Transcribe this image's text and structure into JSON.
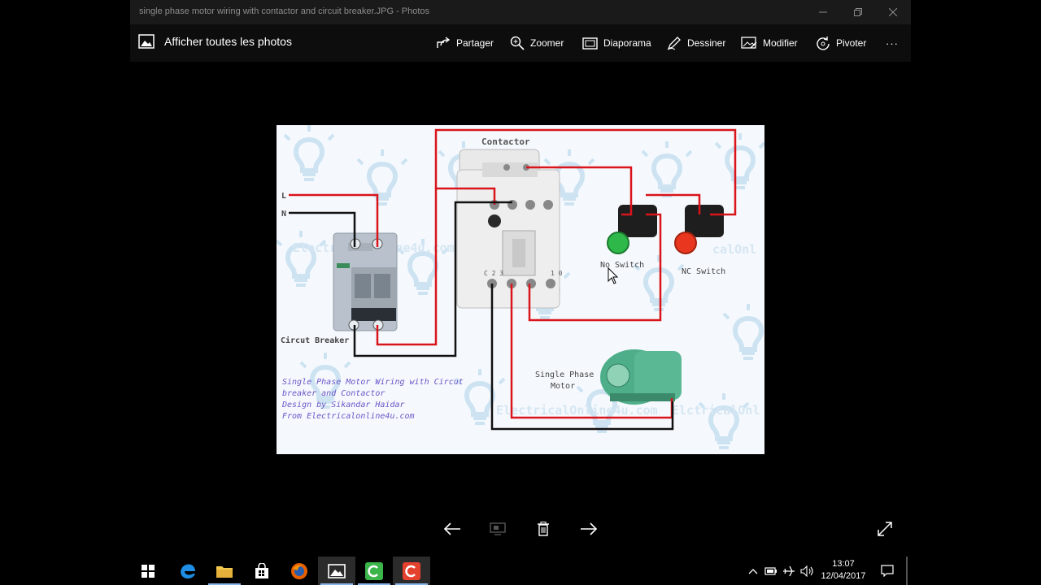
{
  "window": {
    "title": "single phase motor wiring with contactor and circuit breaker.JPG - Photos",
    "minimize_icon": "minimize-icon",
    "maximize_icon": "restore-icon",
    "close_icon": "close-icon"
  },
  "toolbar": {
    "all_photos_label": "Afficher toutes les photos",
    "share_label": "Partager",
    "zoom_label": "Zoomer",
    "slideshow_label": "Diaporama",
    "draw_label": "Dessiner",
    "edit_label": "Modifier",
    "rotate_label": "Pivoter",
    "more_label": "···"
  },
  "diagram": {
    "contactor_label": "Contactor",
    "L_label": "L",
    "N_label": "N",
    "breaker_label": "Circut Breaker",
    "no_switch_label": "No Switch",
    "nc_switch_label": "NC Switch",
    "motor_label_1": "Single Phase",
    "motor_label_2": "Motor",
    "caption_1": "Single Phase Motor Wiring with Circut",
    "caption_2": "breaker and Contactor",
    "caption_3": "Design by Sikandar Haidar",
    "caption_4": "From Electricalonline4u.com",
    "contactor_a1": "C 2 3",
    "contactor_no": "1 0",
    "watermark_1": "Electricalonline4u.com",
    "watermark_2": "ElectricalOnline4u.com",
    "watermark_3": "ElctricalOnl",
    "watermark_4": "calOnl",
    "colors": {
      "live": "#d9141b",
      "neutral": "#111111",
      "green": "#2fb84a",
      "red": "#e9361f",
      "caption": "#6a55c8"
    }
  },
  "taskbar": {
    "time": "13:07",
    "date": "12/04/2017"
  }
}
